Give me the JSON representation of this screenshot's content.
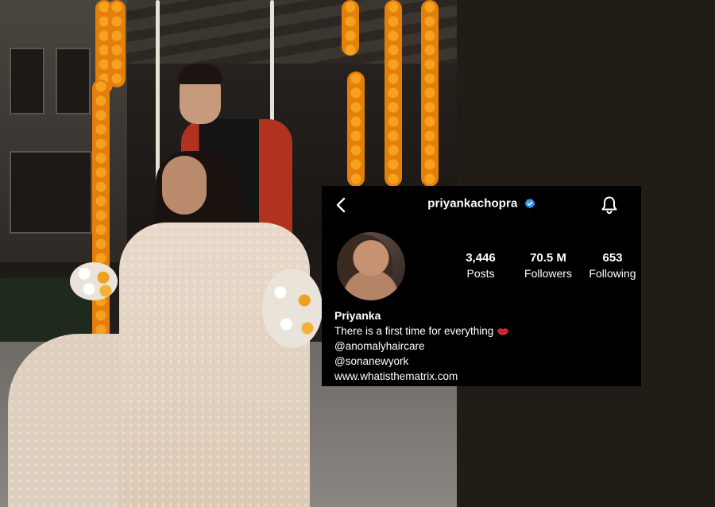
{
  "profile": {
    "username": "priyankachopra",
    "verified": true,
    "display_name": "Priyanka",
    "bio_line": "There is a first time for everything",
    "bio_emoji": "lips-icon",
    "mentions": [
      "@anomalyhaircare",
      "@sonanewyork"
    ],
    "website": "www.whatisthematrix.com"
  },
  "stats": {
    "posts_count": "3,446",
    "posts_label": "Posts",
    "followers_count": "70.5 M",
    "followers_label": "Followers",
    "following_count": "653",
    "following_label": "Following"
  },
  "icons": {
    "back": "chevron-left-icon",
    "verified": "verified-badge-icon",
    "notifications": "bell-icon"
  },
  "colors": {
    "card_background": "#000000",
    "verified_blue": "#3897f0",
    "page_background": "#221c17",
    "lips_red": "#d42a3c"
  }
}
